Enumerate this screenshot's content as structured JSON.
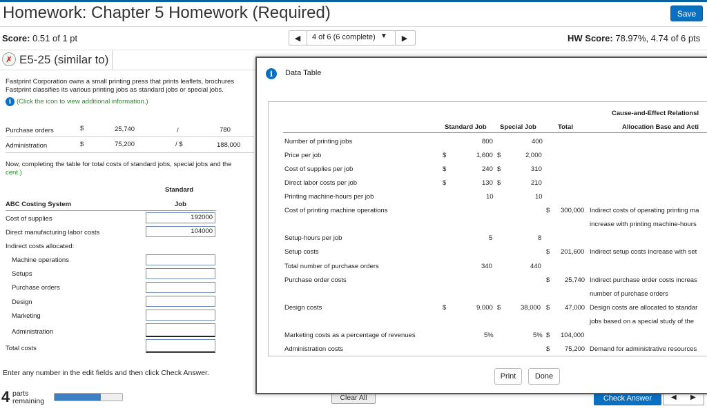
{
  "header": {
    "title": "Homework: Chapter 5 Homework (Required)",
    "save_label": "Save",
    "score_label": "Score:",
    "score_value": "0.51 of 1 pt",
    "nav_prev": "◀",
    "nav_label": "4 of 6 (6 complete)",
    "nav_caret": "▼",
    "nav_next": "▶",
    "hw_score_label": "HW Score:",
    "hw_score_value": "78.97%, 4.74 of 6 pts"
  },
  "question": {
    "title": "E5-25 (similar to)",
    "problem_line1": "Fastprint Corporation owns a small printing press that prints leaflets, brochures",
    "problem_line2": "Fastprint classifies its various printing jobs as standard jobs or special jobs.",
    "info_text": "(Click the icon to view additional information.)"
  },
  "partial_rows": [
    {
      "label": "Purchase orders",
      "dollar": "$",
      "amount": "25,740",
      "slash": "/",
      "dollar2": "",
      "right": "780"
    },
    {
      "label": "Administration",
      "dollar": "$",
      "amount": "75,200",
      "slash": "/ $",
      "dollar2": "",
      "right": "188,000"
    }
  ],
  "instruction_line1": "Now, completing the table for total costs of standard jobs, special jobs and the",
  "instruction_line2": "cent.)",
  "abc_table": {
    "col_header_line1": "Standard",
    "col_header_line2": "Job",
    "system_label": "ABC Costing System",
    "rows": [
      {
        "label": "Cost of supplies",
        "value": "192000"
      },
      {
        "label": "Direct manufacturing labor costs",
        "value": "104000"
      },
      {
        "label": "Indirect costs allocated:",
        "value": ""
      },
      {
        "label": "Machine operations",
        "value": ""
      },
      {
        "label": "Setups",
        "value": ""
      },
      {
        "label": "Purchase orders",
        "value": ""
      },
      {
        "label": "Design",
        "value": ""
      },
      {
        "label": "Marketing",
        "value": ""
      },
      {
        "label": "Administration",
        "value": ""
      },
      {
        "label": "Total costs",
        "value": ""
      }
    ]
  },
  "footer": {
    "hint": "Enter any number in the edit fields and then click Check Answer.",
    "parts_number": "4",
    "parts_line1": "parts",
    "parts_line2": "remaining",
    "progress_fraction": 0.68,
    "clear_label": "Clear All",
    "check_label": "Check Answer",
    "arrow_left": "◀",
    "arrow_right": "▶"
  },
  "modal": {
    "title": "Data Table",
    "print_label": "Print",
    "done_label": "Done",
    "headers": {
      "standard": "Standard Job",
      "special": "Special Job",
      "total": "Total",
      "cause_line1": "Cause-and-Effect Relationsl",
      "cause_line2": "Allocation Base and Acti"
    },
    "rows": {
      "r1": {
        "label": "Number of printing jobs",
        "std": "800",
        "spc": "400"
      },
      "r2": {
        "label": "Price per job",
        "d1": "$",
        "std": "1,600",
        "d2": "$",
        "spc": "2,000"
      },
      "r3": {
        "label": "Cost of supplies per job",
        "d1": "$",
        "std": "240",
        "d2": "$",
        "spc": "310"
      },
      "r4": {
        "label": "Direct labor costs per job",
        "d1": "$",
        "std": "130",
        "d2": "$",
        "spc": "210"
      },
      "r5": {
        "label": "Printing machine-hours per job",
        "std": "10",
        "spc": "10"
      },
      "r6": {
        "label": "Cost of printing machine operations",
        "d3": "$",
        "total": "300,000",
        "desc1": "Indirect costs of operating printing ma",
        "desc2": "increase with printing machine-hours"
      },
      "r7": {
        "label": "Setup-hours per job",
        "std": "5",
        "spc": "8"
      },
      "r8": {
        "label": "Setup costs",
        "d3": "$",
        "total": "201,600",
        "desc1": "Indirect setup costs increase with set"
      },
      "r9": {
        "label": "Total number of purchase orders",
        "std": "340",
        "spc": "440"
      },
      "r10": {
        "label": "Purchase order costs",
        "d3": "$",
        "total": "25,740",
        "desc1": "Indirect purchase order costs increas",
        "desc2": "number of purchase orders"
      },
      "r11": {
        "label": "Design costs",
        "d1": "$",
        "std": "9,000",
        "d2": "$",
        "spc": "38,000",
        "d3": "$",
        "total": "47,000",
        "desc1": "Design costs are allocated to standar",
        "desc2": "jobs based on a special study of the"
      },
      "r12": {
        "label": "Marketing costs as a percentage of revenues",
        "std": "5%",
        "spc": "5%",
        "d3": "$",
        "total": "104,000"
      },
      "r13": {
        "label": "Administration costs",
        "d3": "$",
        "total": "75,200",
        "desc1": "Demand for administrative resources"
      }
    }
  }
}
